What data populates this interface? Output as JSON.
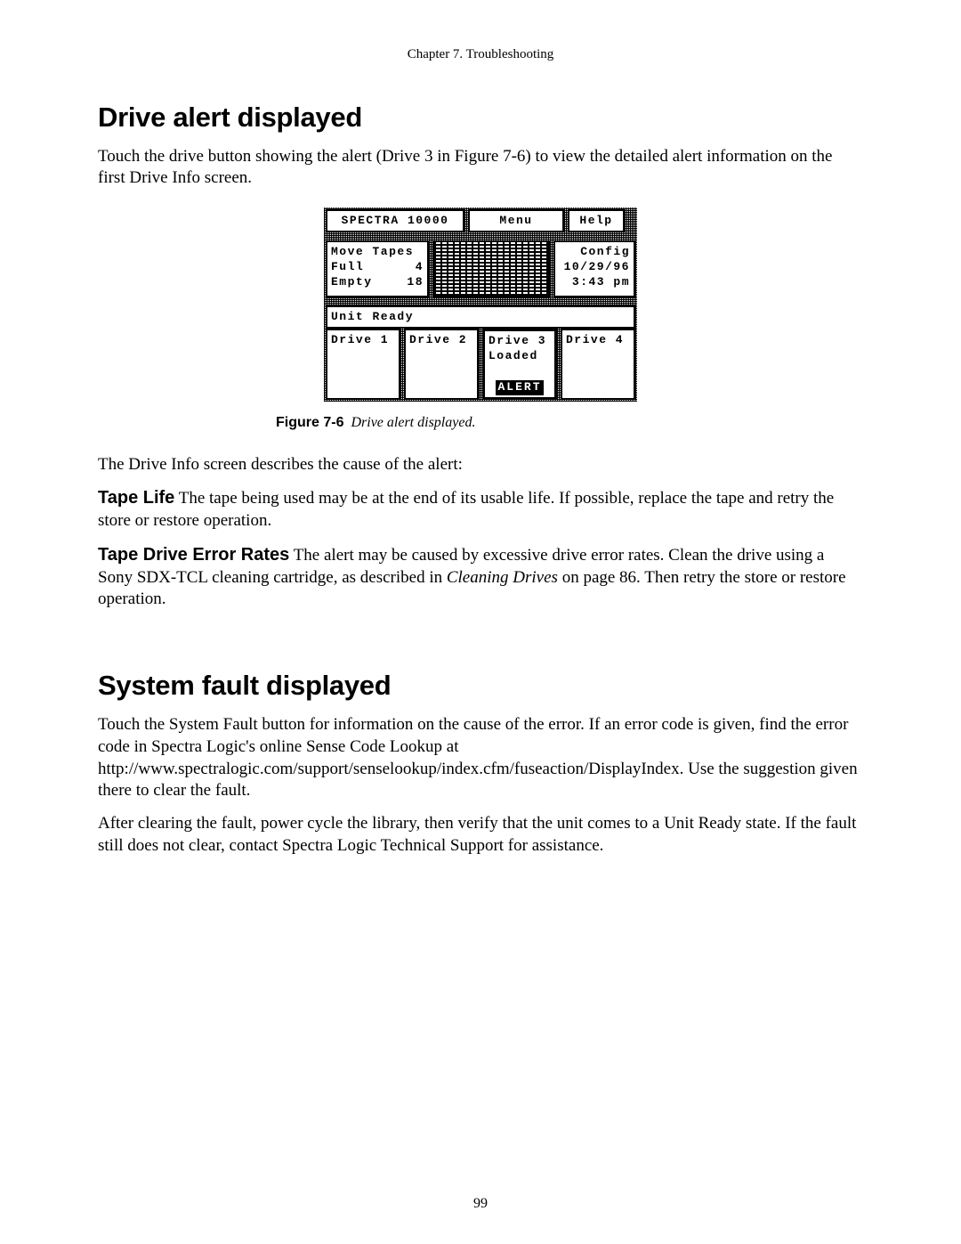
{
  "header": {
    "running": "Chapter 7.  Troubleshooting"
  },
  "sec1": {
    "title": "Drive alert displayed",
    "intro": "Touch the drive button showing the alert (Drive 3 in Figure 7-6) to view the detailed alert information on the first Drive Info screen."
  },
  "lcd": {
    "product": "SPECTRA 10000",
    "menu": "Menu",
    "help": "Help",
    "move": {
      "title": "Move Tapes",
      "full_label": "Full",
      "full_value": "4",
      "empty_label": "Empty",
      "empty_value": "18"
    },
    "config": {
      "title": "Config",
      "date": "10/29/96",
      "time": "3:43 pm"
    },
    "status": "Unit Ready",
    "drives": {
      "d1": "Drive 1",
      "d2": "Drive 2",
      "d3": "Drive 3",
      "d3_state": "Loaded",
      "d3_alert": "ALERT",
      "d4": "Drive 4"
    }
  },
  "figure": {
    "label": "Figure 7-6",
    "title": "Drive alert displayed."
  },
  "after_fig": "The Drive Info screen describes the cause of the alert:",
  "tape_life": {
    "lead": "Tape Life",
    "body": "  The tape being used may be at the end of its usable life. If possible, replace the tape and retry the store or restore operation."
  },
  "err_rates": {
    "lead": "Tape Drive Error Rates",
    "part1": "  The alert may be caused by excessive drive error rates. Clean the drive using a Sony SDX-TCL cleaning cartridge, as described in ",
    "em": "Cleaning Drives",
    "part2": " on page 86. Then retry the store or restore operation."
  },
  "sec2": {
    "title": "System fault displayed",
    "p1": "Touch the System Fault button for information on the cause of the error. If an error code is given, find the error code in Spectra Logic's online Sense Code Lookup at http://www.spectralogic.com/support/senselookup/index.cfm/fuseaction/DisplayIndex. Use the suggestion given there to clear the fault.",
    "p2": "After clearing the fault, power cycle the library, then verify that the unit comes to a Unit Ready state. If the fault still does not clear, contact Spectra Logic Technical Support for assistance."
  },
  "page_no": "99"
}
